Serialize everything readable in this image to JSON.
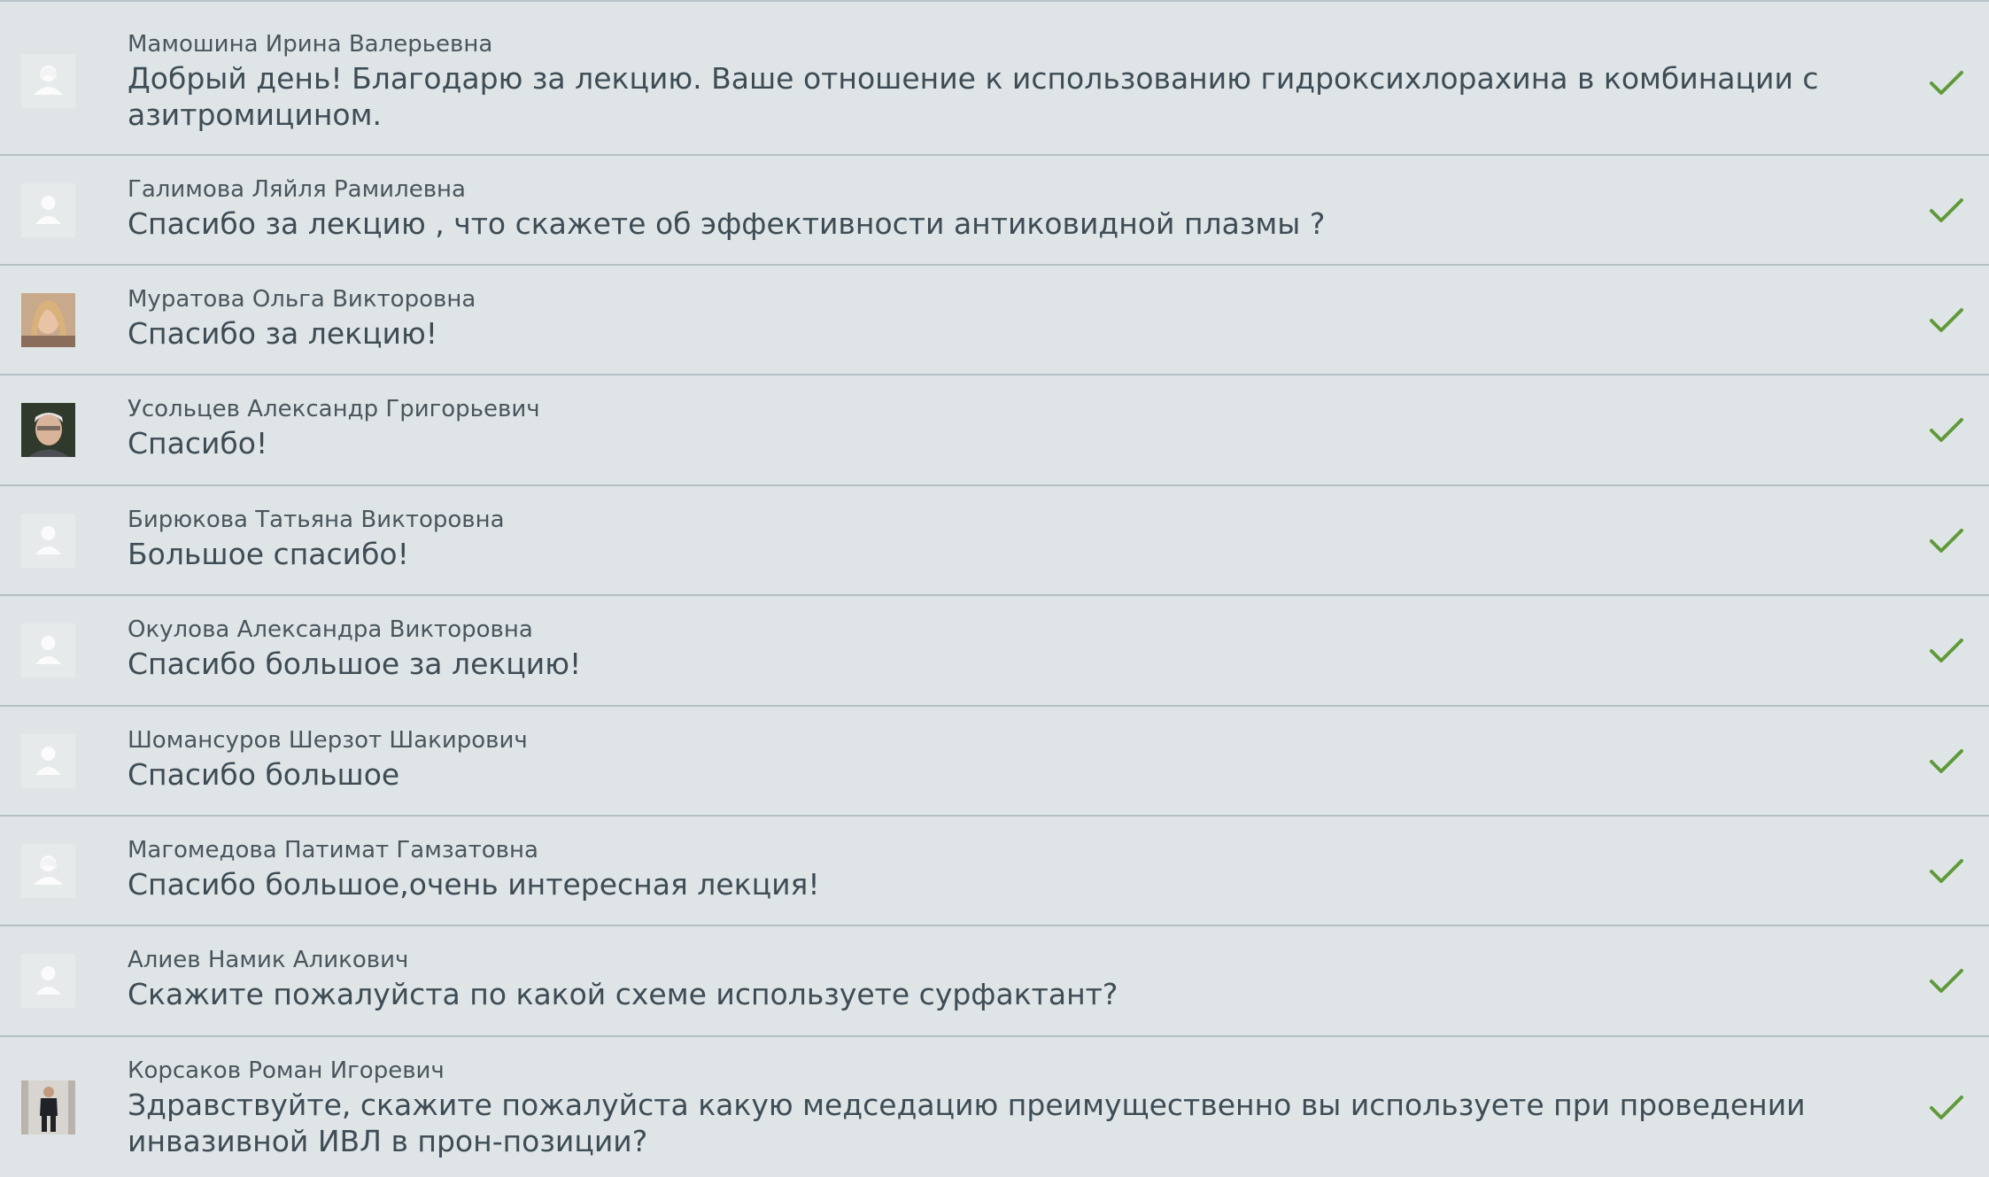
{
  "comments": [
    {
      "author": "Мамошина Ирина Валерьевна",
      "message": "Добрый день! Благодарю за лекцию. Ваше отношение к использованию гидроксихлорахина в комбинации с азитромицином.",
      "avatar": "female-placeholder-icon",
      "status": "approved-check-icon"
    },
    {
      "author": "Галимова Ляйля Рамилевна",
      "message": "Спасибо за лекцию , что скажете об эффективности антиковидной плазмы ?",
      "avatar": "user-placeholder-icon",
      "status": "approved-check-icon"
    },
    {
      "author": "Муратова Ольга Викторовна",
      "message": "Спасибо за лекцию!",
      "avatar": "user-photo",
      "status": "approved-check-icon"
    },
    {
      "author": "Усольцев Александр Григорьевич",
      "message": "Спасибо!",
      "avatar": "user-photo",
      "status": "approved-check-icon"
    },
    {
      "author": "Бирюкова Татьяна Викторовна",
      "message": "Большое спасибо!",
      "avatar": "user-placeholder-icon",
      "status": "approved-check-icon"
    },
    {
      "author": "Окулова Александра Викторовна",
      "message": "Спасибо большое за лекцию!",
      "avatar": "user-placeholder-icon",
      "status": "approved-check-icon"
    },
    {
      "author": "Шомансуров Шерзот Шакирович",
      "message": "Спасибо большое",
      "avatar": "user-placeholder-icon",
      "status": "approved-check-icon"
    },
    {
      "author": "Магомедова Патимат Гамзатовна",
      "message": "Спасибо большое,очень интересная лекция!",
      "avatar": "female-placeholder-icon",
      "status": "approved-check-icon"
    },
    {
      "author": "Алиев Намик Аликович",
      "message": "Скажите пожалуйста по какой схеме используете сурфактант?",
      "avatar": "user-placeholder-icon",
      "status": "approved-check-icon"
    },
    {
      "author": "Корсаков Роман Игоревич",
      "message": "Здравствуйте, скажите пожалуйста какую медседацию преимущественно вы используете при проведении инвазивной ИВЛ в прон-позиции?",
      "avatar": "user-photo",
      "status": "approved-check-icon"
    }
  ],
  "colors": {
    "background": "#dfe5e7",
    "divider": "#b4bfc3",
    "text": "#3e4c55",
    "check": "#5f9a3a"
  }
}
